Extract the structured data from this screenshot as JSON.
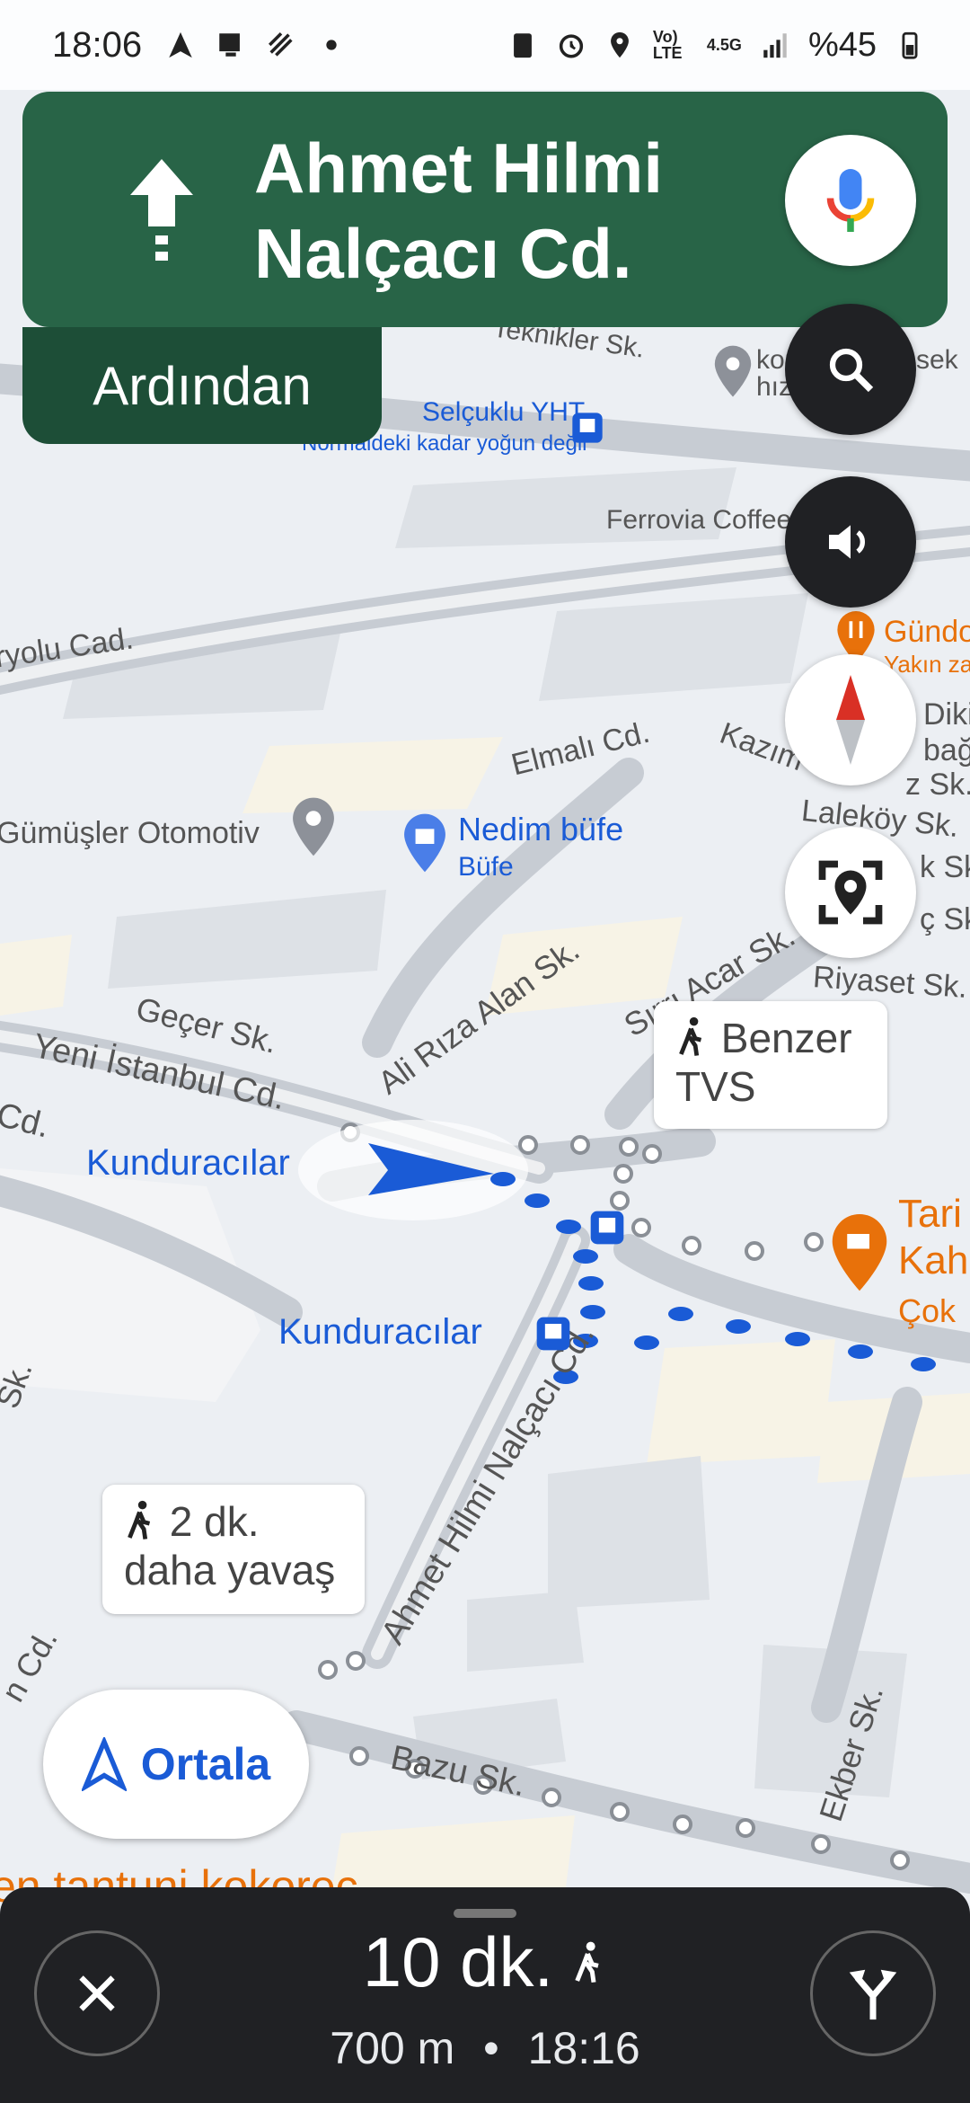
{
  "status_bar": {
    "time": "18:06",
    "battery": "%45",
    "network_label": "4.5G",
    "volte_label": "Vo) LTE",
    "icons": [
      "navigation-icon",
      "screen-icon",
      "link-icon",
      "dot-icon",
      "clipboard-icon",
      "alarm-icon",
      "location-icon",
      "signal-icon",
      "battery-icon"
    ]
  },
  "navigation": {
    "maneuver_icon": "arrow-up-icon",
    "street": "Ahmet Hilmi Nalçacı Cd.",
    "then_label": "Ardından"
  },
  "map": {
    "street_labels": {
      "teknikler": "Teknikler Sk.",
      "elmali": "Elmalı Cd.",
      "yeni_istanbul": "Yeni İstanbul Cd.",
      "gecer": "Geçer Sk.",
      "ali_riza": "Ali Rıza Alan Sk.",
      "sirri_acar": "Sırrı Acar Sk.",
      "riyaset": "Riyaset Sk.",
      "lalekoy": "Laleköy Sk.",
      "kazim": "Kazım",
      "ahmet_hilmi": "Ahmet Hilmi Nalçacı Cd.",
      "bazu": "Bazu Sk.",
      "ekber": "Ekber Sk.",
      "ryolu": "ryolu Cad.",
      "cd_left": "Cd.",
      "cd_left2": "n Cd.",
      "sk_left": "Sk."
    },
    "places": {
      "selcuklu": "Selçuklu YHT",
      "selcuklu_sub": "Normaldeki kadar yoğun değil",
      "ferrovia": "Ferrovia Coffee",
      "gundo": "Gündo",
      "gundo_sub": "Yakın za",
      "diki": "Diki",
      "bag": "bağ",
      "sk_right": "z Sk.",
      "k_sk": "k Sk.",
      "c_sk": "ç Sk",
      "gumusler": "Gümüşler Otomotiv",
      "nedim": "Nedim büfe",
      "nedim_sub": "Büfe",
      "kunduracilar1": "Kunduracılar",
      "kunduracilar2": "Kunduracılar",
      "tari": "Tari",
      "kah": "Kah",
      "cok": "Çok",
      "kor": "kor",
      "hiz": "hız",
      "esek": "sek",
      "tantuni": "en tantuni kokoreç"
    },
    "bubbles": {
      "benzer_line1": "Benzer",
      "benzer_line2": "TVS",
      "slower_line1": "2 dk.",
      "slower_line2": "daha yavaş"
    }
  },
  "recenter_label": "Ortala",
  "bottom_sheet": {
    "duration": "10 dk.",
    "distance": "700 m",
    "separator": "•",
    "arrival": "18:16"
  }
}
